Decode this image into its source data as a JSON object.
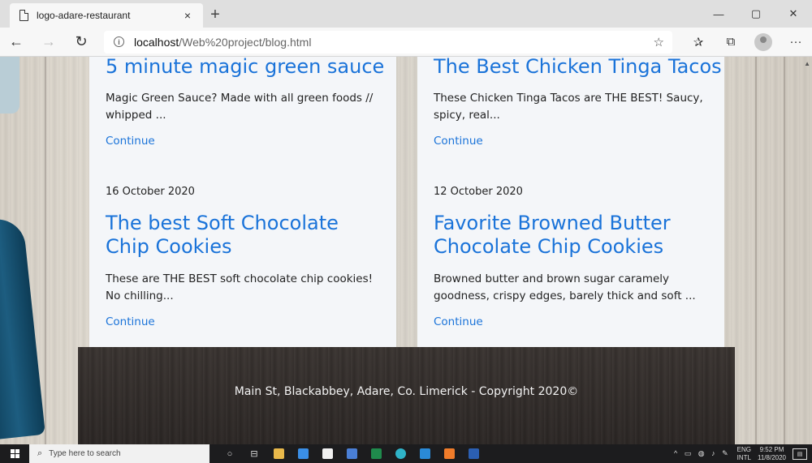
{
  "browser": {
    "tab_title": "logo-adare-restaurant",
    "tab_close": "×",
    "new_tab": "+",
    "url_host": "localhost",
    "url_path": "/Web%20project/blog.html",
    "window_minimize": "—",
    "window_restore": "▢",
    "window_close": "✕"
  },
  "posts": [
    {
      "title": "5 minute magic green sauce",
      "excerpt": "Magic Green Sauce? Made with all green foods // whipped ...",
      "link": "Continue"
    },
    {
      "title": "The Best Chicken Tinga Tacos",
      "excerpt": "These Chicken Tinga Tacos are THE BEST! Saucy, spicy, real...",
      "link": "Continue"
    },
    {
      "date": "16 October 2020",
      "title": "The best Soft Chocolate Chip Cookies",
      "excerpt": "These are THE BEST soft chocolate chip cookies! No chilling...",
      "link": "Continue"
    },
    {
      "date": "12 October 2020",
      "title": "Favorite Browned Butter Chocolate Chip Cookies",
      "excerpt": "Browned butter and brown sugar caramely goodness, crispy edges, barely thick and soft ...",
      "link": "Continue"
    }
  ],
  "footer": {
    "text": "Main St, Blackabbey, Adare, Co. Limerick - Copyright 2020©"
  },
  "taskbar": {
    "search_placeholder": "Type here to search",
    "lang_top": "ENG",
    "lang_bottom": "INTL",
    "time": "9:52 PM",
    "date": "11/8/2020"
  },
  "colors": {
    "link_blue": "#1a73d9",
    "card_bg": "#f4f6f9",
    "footer_bg": "#2d2826"
  }
}
